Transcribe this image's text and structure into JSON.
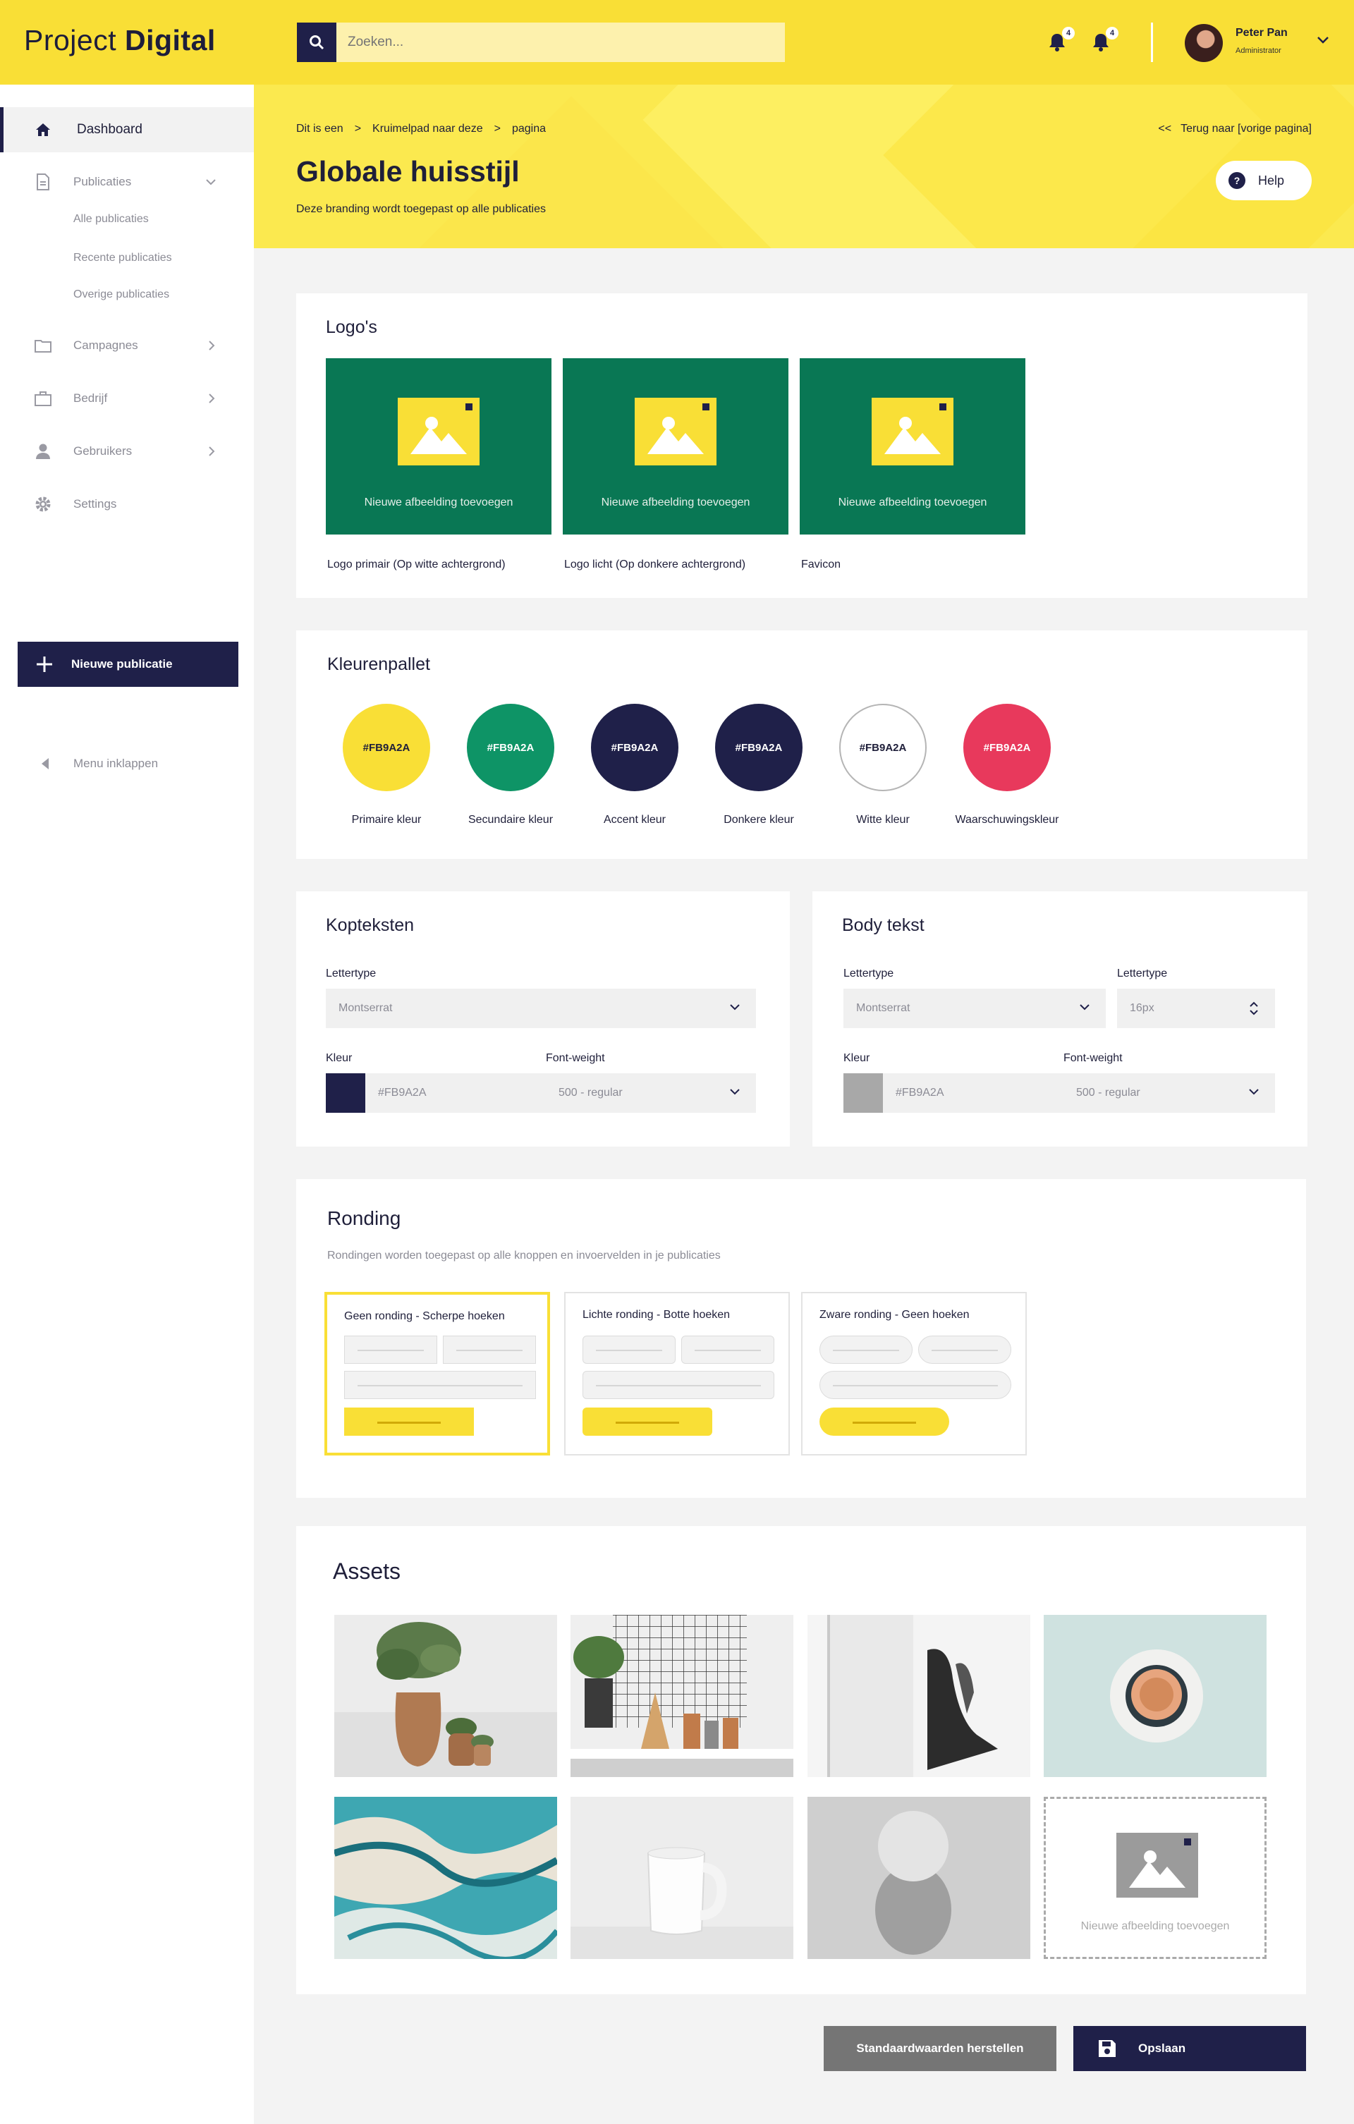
{
  "brand": {
    "light": "Project ",
    "bold": "Digital"
  },
  "search": {
    "placeholder": "Zoeken..."
  },
  "notifications": [
    {
      "count": "4"
    },
    {
      "count": "4"
    }
  ],
  "user": {
    "name": "Peter Pan",
    "role": "Administrator"
  },
  "sidebar": {
    "items": [
      {
        "label": "Dashboard",
        "icon": "home-icon"
      },
      {
        "label": "Publicaties",
        "icon": "document-icon"
      },
      {
        "label": "Campagnes",
        "icon": "folder-icon"
      },
      {
        "label": "Bedrijf",
        "icon": "briefcase-icon"
      },
      {
        "label": "Gebruikers",
        "icon": "user-icon"
      },
      {
        "label": "Settings",
        "icon": "gear-icon"
      }
    ],
    "sub_items": [
      "Alle publicaties",
      "Recente publicaties",
      "Overige publicaties"
    ],
    "new_button": "Nieuwe publicatie",
    "collapse": "Menu inklappen"
  },
  "header": {
    "breadcrumb": [
      "Dit is een",
      ">",
      "Kruimelpad naar deze",
      ">",
      "pagina"
    ],
    "back": "<<   Terug naar [vorige pagina]",
    "title": "Globale huisstijl",
    "subtitle": "Deze branding wordt toegepast op alle publicaties",
    "help": "Help"
  },
  "logos": {
    "title": "Logo's",
    "add_text": "Nieuwe afbeelding toevoegen",
    "captions": [
      "Logo primair (Op witte achtergrond)",
      "Logo licht (Op donkere achtergrond)",
      "Favicon"
    ]
  },
  "palette": {
    "title": "Kleurenpallet",
    "swatches": [
      {
        "hex": "#FB9A2A",
        "label": "Primaire kleur",
        "color": "#f9df36",
        "text_color": "#1f1f3a"
      },
      {
        "hex": "#FB9A2A",
        "label": "Secundaire kleur",
        "color": "#0e9466",
        "text_color": "#ffffff"
      },
      {
        "hex": "#FB9A2A",
        "label": "Accent kleur",
        "color": "#1f2049",
        "text_color": "#ffffff"
      },
      {
        "hex": "#FB9A2A",
        "label": "Donkere kleur",
        "color": "#1f2049",
        "text_color": "#ffffff"
      },
      {
        "hex": "#FB9A2A",
        "label": "Witte kleur",
        "color": "#ffffff",
        "text_color": "#1f1f3a"
      },
      {
        "hex": "#FB9A2A",
        "label": "Waarschuwingskleur",
        "color": "#e8395c",
        "text_color": "#ffffff"
      }
    ]
  },
  "headings": {
    "title": "Kopteksten",
    "font_label": "Lettertype",
    "font_value": "Montserrat",
    "color_label": "Kleur",
    "color_value": "#FB9A2A",
    "color_swatch": "#1f2049",
    "weight_label": "Font-weight",
    "weight_value": "500 - regular"
  },
  "body_text": {
    "title": "Body tekst",
    "font_label": "Lettertype",
    "font_value": "Montserrat",
    "size_label": "Lettertype",
    "size_value": "16px",
    "color_label": "Kleur",
    "color_value": "#FB9A2A",
    "color_swatch": "#a8a8a8",
    "weight_label": "Font-weight",
    "weight_value": "500 - regular"
  },
  "rounding": {
    "title": "Ronding",
    "subtitle": "Rondingen worden toegepast op alle knoppen en invoervelden in je publicaties",
    "options": [
      {
        "label": "Geen ronding - Scherpe hoeken",
        "selected": true
      },
      {
        "label": "Lichte ronding - Botte hoeken",
        "selected": false
      },
      {
        "label": "Zware ronding - Geen hoeken",
        "selected": false
      }
    ]
  },
  "assets": {
    "title": "Assets",
    "items": [
      "plant-photo",
      "shelf-photo",
      "figure-photo",
      "coffee-photo",
      "marble-photo",
      "mug-photo",
      "sphere-photo"
    ],
    "add_text": "Nieuwe afbeelding toevoegen"
  },
  "actions": {
    "reset": "Standaardwaarden herstellen",
    "save": "Opslaan"
  }
}
